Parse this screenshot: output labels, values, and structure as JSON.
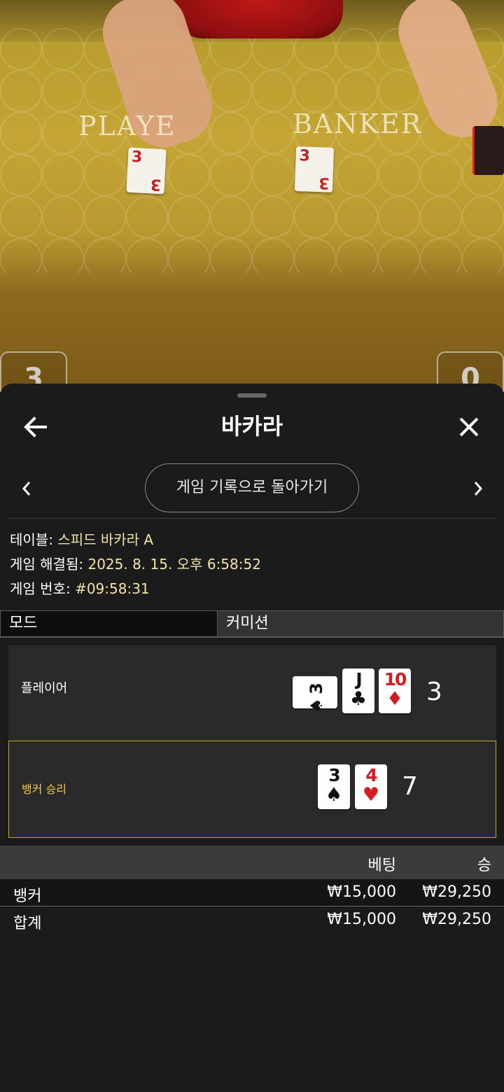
{
  "video": {
    "player_label": "PLAYE",
    "banker_label": "BANKER",
    "player_felt_card": {
      "rank": "3",
      "suit": "♦"
    },
    "banker_felt_card": {
      "rank": "3",
      "suit": "♥"
    },
    "score_left": "3",
    "score_right": "0"
  },
  "header": {
    "title": "바카라",
    "back_icon": "arrow-left-icon",
    "close_icon": "close-icon"
  },
  "navigation": {
    "back_to_history": "게임 기록으로 돌아가기",
    "prev_icon": "chevron-left-icon",
    "next_icon": "chevron-right-icon"
  },
  "info": {
    "table_key": "테이블:",
    "table_value": "스피드 바카라 A",
    "resolved_key": "게임 해결됨:",
    "resolved_value": "2025. 8. 15. 오후 6:58:52",
    "number_key": "게임 번호:",
    "number_value": "#09:58:31"
  },
  "mode": {
    "label": "모드",
    "value": "커미션"
  },
  "hands": {
    "player": {
      "label": "플레이어",
      "score": "3",
      "cards": [
        {
          "rank": "3",
          "suit": "♠",
          "color": "#111111",
          "orientation": "sideways"
        },
        {
          "rank": "J",
          "suit": "♣",
          "color": "#111111"
        },
        {
          "rank": "10",
          "suit": "♦",
          "color": "#d21d22"
        }
      ]
    },
    "banker": {
      "label": "뱅커 승리",
      "score": "7",
      "cards": [
        {
          "rank": "3",
          "suit": "♠",
          "color": "#111111"
        },
        {
          "rank": "4",
          "suit": "♥",
          "color": "#d21d22"
        }
      ]
    }
  },
  "bets_table": {
    "headers": {
      "bet": "베팅",
      "win": "승"
    },
    "rows": [
      {
        "name": "뱅커",
        "bet": "₩15,000",
        "win": "₩29,250"
      },
      {
        "name": "합계",
        "bet": "₩15,000",
        "win": "₩29,250"
      }
    ]
  },
  "colors": {
    "accent_gold": "#c9a722",
    "banker_win_text": "#f2c94c",
    "info_value": "#f3e3a6"
  }
}
